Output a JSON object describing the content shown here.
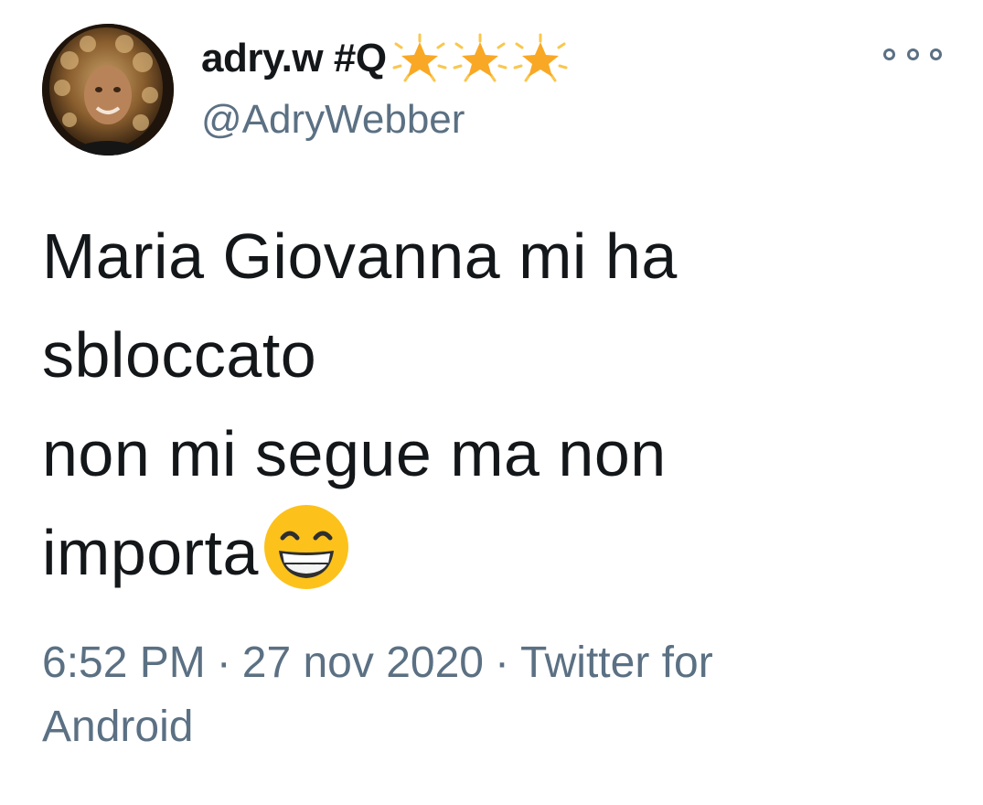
{
  "tweet": {
    "author": {
      "display_name": "adry.w #Q",
      "badges": [
        "star-icon",
        "star-icon",
        "star-icon"
      ],
      "handle": "@AdryWebber"
    },
    "more_icon": "more-options-icon",
    "text_lines": [
      "Maria Giovanna mi ha",
      "sbloccato",
      "non mi segue ma non",
      "importa"
    ],
    "emoji": "grinning-face-icon",
    "time": "6:52 PM",
    "separator": "·",
    "date": "27 nov 2020",
    "source_line1": "Twitter for",
    "source_line2": "Android"
  },
  "colors": {
    "text": "#14171a",
    "secondary": "#5b7083",
    "star": "#f9a825",
    "emoji_face": "#fcc21b"
  }
}
